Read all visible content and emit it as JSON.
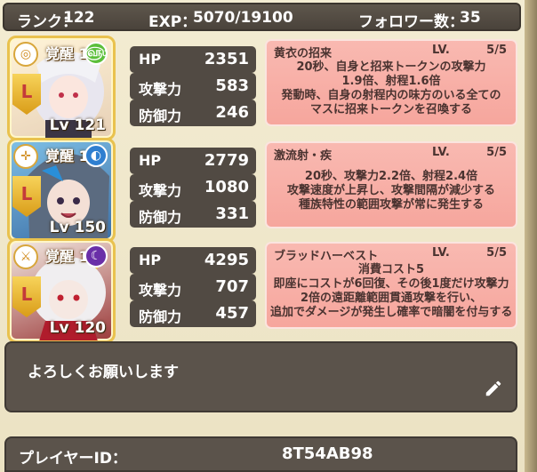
{
  "header": {
    "rank_label": "ランク：",
    "rank_value": "122",
    "exp_label": "EXP：",
    "exp_value": "5070/19100",
    "followers_label": "フォロワー数：",
    "followers_value": "35"
  },
  "units": [
    {
      "awaken": "覚醒 1",
      "level": "Lv 121",
      "rank_badge": "L",
      "element_icon": "wind-element-icon",
      "element_color": "#5bbf3a",
      "stats": [
        {
          "label": "HP",
          "value": "2351"
        },
        {
          "label": "攻撃力",
          "value": "583"
        },
        {
          "label": "防御力",
          "value": "246"
        }
      ],
      "skill": {
        "name": "黄衣の招来",
        "lv_label": "LV.",
        "lv_value": "5/5",
        "lines": [
          "20秒、自身と招来トークンの攻撃力",
          "1.9倍、射程1.6倍",
          "発動時、自身の射程内の味方のいる全ての",
          "マスに招来トークンを召喚する"
        ]
      }
    },
    {
      "awaken": "覚醒 1",
      "level": "Lv 150",
      "rank_badge": "L",
      "element_icon": "water-element-icon",
      "element_color": "#2f7fd0",
      "stats": [
        {
          "label": "HP",
          "value": "2779"
        },
        {
          "label": "攻撃力",
          "value": "1080"
        },
        {
          "label": "防御力",
          "value": "331"
        }
      ],
      "skill": {
        "name": "激流射・疾",
        "lv_label": "LV.",
        "lv_value": "5/5",
        "lines": [
          "20秒、攻撃力2.2倍、射程2.4倍",
          "攻撃速度が上昇し、攻撃間隔が減少する",
          "種族特性の範囲攻撃が常に発生する"
        ]
      }
    },
    {
      "awaken": "覚醒 1",
      "level": "Lv 120",
      "rank_badge": "L",
      "element_icon": "dark-element-icon",
      "element_color": "#6a2fa8",
      "stats": [
        {
          "label": "HP",
          "value": "4295"
        },
        {
          "label": "攻撃力",
          "value": "707"
        },
        {
          "label": "防御力",
          "value": "457"
        }
      ],
      "skill": {
        "name": "ブラッドハーベスト",
        "lv_label": "LV.",
        "lv_value": "5/5",
        "lines": [
          "消費コスト5",
          "即座にコストが6回復、その後1度だけ攻撃力",
          "2倍の遠距離範囲貫通攻撃を行い、",
          "追加でダメージが発生し確率で暗闇を付与する"
        ]
      }
    }
  ],
  "comment": {
    "text": "よろしくお願いします",
    "edit_icon": "pencil-icon"
  },
  "player": {
    "id_label": "プレイヤーID：",
    "id_value": "8T54AB98"
  }
}
